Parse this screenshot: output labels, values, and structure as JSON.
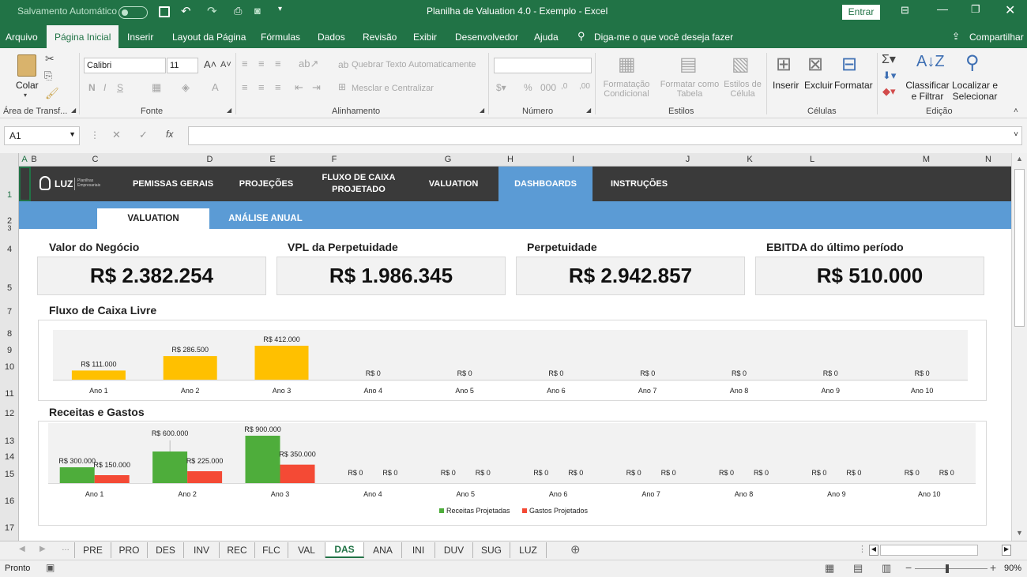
{
  "titlebar": {
    "autosave_label": "Salvamento Automático",
    "autosave_state": "Desativado",
    "title": "Planilha de Valuation 4.0 - Exemplo  -  Excel",
    "signin_label": "Entrar"
  },
  "ribbon_tabs": [
    "Arquivo",
    "Página Inicial",
    "Inserir",
    "Layout da Página",
    "Fórmulas",
    "Dados",
    "Revisão",
    "Exibir",
    "Desenvolvedor",
    "Ajuda"
  ],
  "tell_me": "Diga-me o que você deseja fazer",
  "share_label": "Compartilhar",
  "ribbon": {
    "paste_label": "Colar",
    "font_name": "Calibri",
    "font_size": "11",
    "wrap_text": "Quebrar Texto Automaticamente",
    "merge_center": "Mesclar e Centralizar",
    "cond_format": "Formatação Condicional",
    "format_table": "Formatar como Tabela",
    "cell_styles": "Estilos de Célula",
    "insert": "Inserir",
    "delete": "Excluir",
    "format": "Formatar",
    "sort_filter": "Classificar e Filtrar",
    "find_select": "Localizar e Selecionar",
    "groups": {
      "clipboard": "Área de Transf...",
      "font": "Fonte",
      "alignment": "Alinhamento",
      "number": "Número",
      "styles": "Estilos",
      "cells": "Células",
      "editing": "Edição"
    }
  },
  "formula_bar": {
    "name_box": "A1",
    "fx": "fx",
    "content": ""
  },
  "columns": [
    "A",
    "B",
    "C",
    "D",
    "E",
    "F",
    "G",
    "H",
    "I",
    "J",
    "K",
    "L",
    "M",
    "N"
  ],
  "rows": [
    "1",
    "2",
    "3",
    "4",
    "5",
    "7",
    "8",
    "9",
    "10",
    "11",
    "12",
    "13",
    "14",
    "15",
    "16",
    "17"
  ],
  "nav": {
    "logo": "LUZ",
    "logo_sub": "Planilhas Empresariais",
    "items": [
      "PEMISSAS GERAIS",
      "PROJEÇÕES",
      "FLUXO DE CAIXA PROJETADO",
      "VALUATION",
      "DASHBOARDS",
      "INSTRUÇÕES"
    ],
    "active": "DASHBOARDS"
  },
  "subtabs": [
    "VALUATION",
    "ANÁLISE ANUAL"
  ],
  "kpis": [
    {
      "title": "Valor do Negócio",
      "value": "R$ 2.382.254"
    },
    {
      "title": "VPL da Perpetuidade",
      "value": "R$ 1.986.345"
    },
    {
      "title": "Perpetuidade",
      "value": "R$ 2.942.857"
    },
    {
      "title": "EBITDA do último período",
      "value": "R$ 510.000"
    }
  ],
  "sections": {
    "fcl": "Fluxo de Caixa Livre",
    "rg": "Receitas e Gastos"
  },
  "colors": {
    "excel_green": "#217346",
    "nav_dark": "#3a3a3a",
    "nav_blue": "#5b9bd5",
    "bar_yellow": "#ffc000",
    "bar_green": "#4ead3b",
    "bar_red": "#f44a35"
  },
  "chart_data": [
    {
      "type": "bar",
      "title": "Fluxo de Caixa Livre",
      "categories": [
        "Ano 1",
        "Ano 2",
        "Ano 3",
        "Ano 4",
        "Ano 5",
        "Ano 6",
        "Ano 7",
        "Ano 8",
        "Ano 9",
        "Ano 10"
      ],
      "values": [
        111000,
        286500,
        412000,
        0,
        0,
        0,
        0,
        0,
        0,
        0
      ],
      "labels": [
        "R$ 111.000",
        "R$ 286.500",
        "R$ 412.000",
        "R$ 0",
        "R$ 0",
        "R$ 0",
        "R$ 0",
        "R$ 0",
        "R$ 0",
        "R$ 0"
      ],
      "ylim": [
        0,
        412000
      ],
      "grid": false,
      "legend": "none"
    },
    {
      "type": "bar",
      "title": "Receitas e Gastos",
      "categories": [
        "Ano 1",
        "Ano 2",
        "Ano 3",
        "Ano 4",
        "Ano 5",
        "Ano 6",
        "Ano 7",
        "Ano 8",
        "Ano 9",
        "Ano 10"
      ],
      "series": [
        {
          "name": "Receitas Projetadas",
          "values": [
            300000,
            600000,
            900000,
            0,
            0,
            0,
            0,
            0,
            0,
            0
          ],
          "labels": [
            "R$ 300.000",
            "R$ 600.000",
            "R$ 900.000",
            "R$ 0",
            "R$ 0",
            "R$ 0",
            "R$ 0",
            "R$ 0",
            "R$ 0",
            "R$ 0"
          ]
        },
        {
          "name": "Gastos Projetados",
          "values": [
            150000,
            225000,
            350000,
            0,
            0,
            0,
            0,
            0,
            0,
            0
          ],
          "labels": [
            "R$ 150.000",
            "R$ 225.000",
            "R$ 350.000",
            "R$ 0",
            "R$ 0",
            "R$ 0",
            "R$ 0",
            "R$ 0",
            "R$ 0",
            "R$ 0"
          ]
        }
      ],
      "ylim": [
        0,
        900000
      ],
      "grid": false,
      "legend": "bottom"
    }
  ],
  "sheet_tabs": [
    "PRE",
    "PRO",
    "DES",
    "INV",
    "REC",
    "FLC",
    "VAL",
    "DAS",
    "ANA",
    "INI",
    "DUV",
    "SUG",
    "LUZ"
  ],
  "active_sheet": "DAS",
  "status": {
    "ready": "Pronto",
    "zoom": "90%"
  }
}
